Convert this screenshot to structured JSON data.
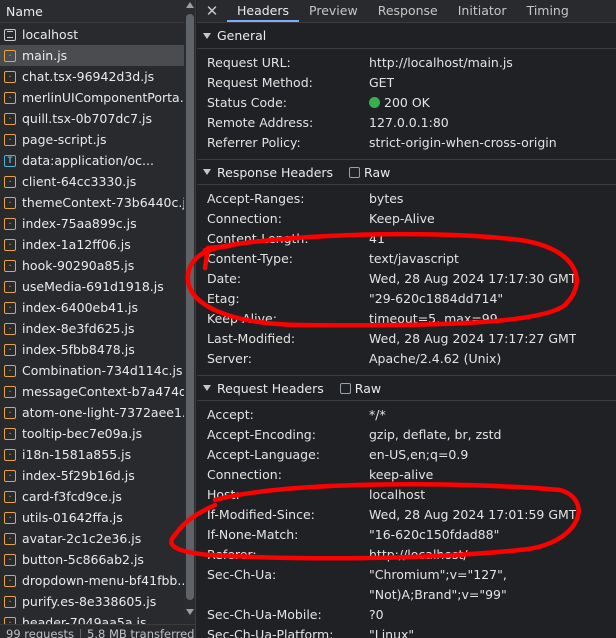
{
  "left_panel": {
    "header": "Name",
    "files": [
      {
        "name": "localhost",
        "icon": "doc",
        "selected": false
      },
      {
        "name": "main.js",
        "icon": "js",
        "selected": true
      },
      {
        "name": "chat.tsx-96942d3d.js",
        "icon": "js",
        "selected": false
      },
      {
        "name": "merlinUIComponentPorta...",
        "icon": "js",
        "selected": false
      },
      {
        "name": "quill.tsx-0b707dc7.js",
        "icon": "js",
        "selected": false
      },
      {
        "name": "page-script.js",
        "icon": "js",
        "selected": false
      },
      {
        "name": "data:application/oc...",
        "icon": "text",
        "selected": false
      },
      {
        "name": "client-64cc3330.js",
        "icon": "js",
        "selected": false
      },
      {
        "name": "themeContext-73b6440c.js",
        "icon": "js",
        "selected": false
      },
      {
        "name": "index-75aa899c.js",
        "icon": "js",
        "selected": false
      },
      {
        "name": "index-1a12ff06.js",
        "icon": "js",
        "selected": false
      },
      {
        "name": "hook-90290a85.js",
        "icon": "js",
        "selected": false
      },
      {
        "name": "useMedia-691d1918.js",
        "icon": "js",
        "selected": false
      },
      {
        "name": "index-6400eb41.js",
        "icon": "js",
        "selected": false
      },
      {
        "name": "index-8e3fd625.js",
        "icon": "js",
        "selected": false
      },
      {
        "name": "index-5fbb8478.js",
        "icon": "js",
        "selected": false
      },
      {
        "name": "Combination-734d114c.js",
        "icon": "js",
        "selected": false
      },
      {
        "name": "messageContext-b7a474d...",
        "icon": "js",
        "selected": false
      },
      {
        "name": "atom-one-light-7372aee1.js",
        "icon": "js",
        "selected": false
      },
      {
        "name": "tooltip-bec7e09a.js",
        "icon": "js",
        "selected": false
      },
      {
        "name": "i18n-1581a855.js",
        "icon": "js",
        "selected": false
      },
      {
        "name": "index-5f29b16d.js",
        "icon": "js",
        "selected": false
      },
      {
        "name": "card-f3fcd9ce.js",
        "icon": "js",
        "selected": false
      },
      {
        "name": "utils-01642ffa.js",
        "icon": "js",
        "selected": false
      },
      {
        "name": "avatar-2c1c2e36.js",
        "icon": "js",
        "selected": false
      },
      {
        "name": "button-5c866ab2.js",
        "icon": "js",
        "selected": false
      },
      {
        "name": "dropdown-menu-bf41fbb...",
        "icon": "js",
        "selected": false
      },
      {
        "name": "purify.es-8e338605.js",
        "icon": "js",
        "selected": false
      },
      {
        "name": "header-7049aa5a.js",
        "icon": "js",
        "selected": false
      }
    ],
    "status": {
      "requests": "99 requests",
      "transferred": "5.8 MB transferred"
    }
  },
  "tabs": {
    "close_glyph": "✕",
    "items": [
      "Headers",
      "Preview",
      "Response",
      "Initiator",
      "Timing"
    ],
    "active": "Headers"
  },
  "sections": {
    "general": {
      "title": "General",
      "rows": [
        {
          "key": "Request URL:",
          "value": "http://localhost/main.js"
        },
        {
          "key": "Request Method:",
          "value": "GET"
        },
        {
          "key": "Status Code:",
          "value": "200 OK",
          "status_dot": true
        },
        {
          "key": "Remote Address:",
          "value": "127.0.0.1:80"
        },
        {
          "key": "Referrer Policy:",
          "value": "strict-origin-when-cross-origin"
        }
      ]
    },
    "response": {
      "title": "Response Headers",
      "raw_label": "Raw",
      "rows": [
        {
          "key": "Accept-Ranges:",
          "value": "bytes"
        },
        {
          "key": "Connection:",
          "value": "Keep-Alive"
        },
        {
          "key": "Content-Length:",
          "value": "41"
        },
        {
          "key": "Content-Type:",
          "value": "text/javascript"
        },
        {
          "key": "Date:",
          "value": "Wed, 28 Aug 2024 17:17:30 GMT"
        },
        {
          "key": "Etag:",
          "value": "\"29-620c1884dd714\""
        },
        {
          "key": "Keep-Alive:",
          "value": "timeout=5, max=99"
        },
        {
          "key": "Last-Modified:",
          "value": "Wed, 28 Aug 2024 17:17:27 GMT"
        },
        {
          "key": "Server:",
          "value": "Apache/2.4.62 (Unix)"
        }
      ]
    },
    "request": {
      "title": "Request Headers",
      "raw_label": "Raw",
      "rows": [
        {
          "key": "Accept:",
          "value": "*/*"
        },
        {
          "key": "Accept-Encoding:",
          "value": "gzip, deflate, br, zstd"
        },
        {
          "key": "Accept-Language:",
          "value": "en-US,en;q=0.9"
        },
        {
          "key": "Connection:",
          "value": "keep-alive"
        },
        {
          "key": "Host:",
          "value": "localhost"
        },
        {
          "key": "If-Modified-Since:",
          "value": "Wed, 28 Aug 2024 17:01:59 GMT"
        },
        {
          "key": "If-None-Match:",
          "value": "\"16-620c150fdad88\""
        },
        {
          "key": "Referer:",
          "value": "http://localhost/"
        },
        {
          "key": "Sec-Ch-Ua:",
          "value": "\"Chromium\";v=\"127\","
        },
        {
          "key": "",
          "value": "\"Not)A;Brand\";v=\"99\""
        },
        {
          "key": "Sec-Ch-Ua-Mobile:",
          "value": "?0"
        },
        {
          "key": "Sec-Ch-Ua-Platform:",
          "value": "\"Linux\""
        }
      ]
    }
  },
  "colors": {
    "annotation": "#ff0000",
    "status_ok": "#36b04a",
    "active_tab_underline": "#7cacf8"
  }
}
